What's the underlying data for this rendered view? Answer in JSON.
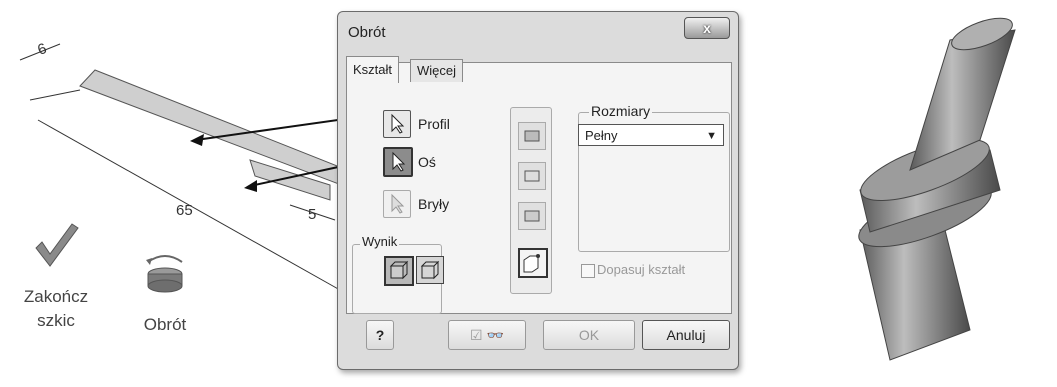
{
  "sketch": {
    "dim_6": "6",
    "dim_65": "65",
    "dim_5": "5",
    "finish_label_line1": "Zakończ",
    "finish_label_line2": "szkic",
    "revolve_label": "Obrót"
  },
  "dialog": {
    "title": "Obrót",
    "close_glyph": "x",
    "tabs": [
      {
        "label": "Kształt"
      },
      {
        "label": "Więcej"
      }
    ],
    "selectors": [
      {
        "label": "Profil"
      },
      {
        "label": "Oś"
      },
      {
        "label": "Bryły"
      }
    ],
    "output_group_label": "Wynik",
    "size_group_label": "Rozmiary",
    "extent_selected": "Pełny",
    "match_shape_label": "Dopasuj kształt",
    "ok_label": "OK",
    "cancel_label": "Anuluj",
    "help_glyph": "?",
    "preview_check": "☑"
  }
}
